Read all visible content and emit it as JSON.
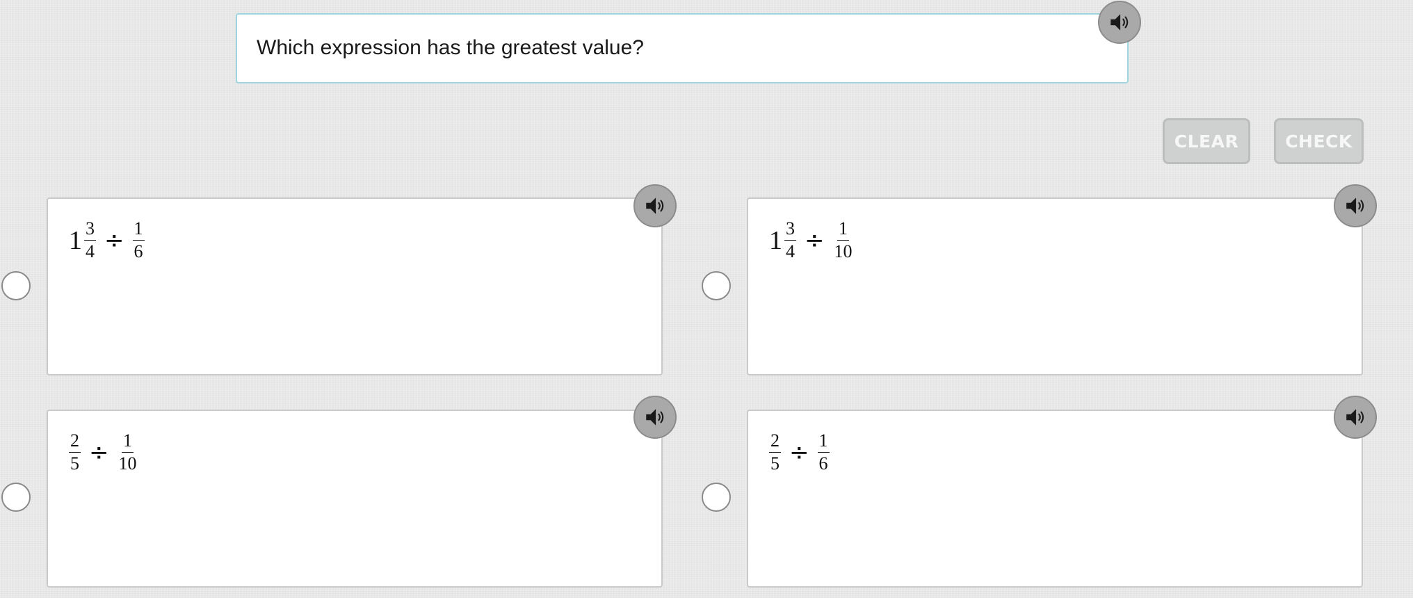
{
  "question": {
    "text": "Which expression has the greatest value?"
  },
  "buttons": {
    "clear_label": "CLEAR",
    "check_label": "CHECK"
  },
  "icons": {
    "audio": "speaker-icon",
    "radio": "radio-unselected-icon"
  },
  "colors": {
    "question_border": "#9fd5e0",
    "button_bg": "#cfd0d0",
    "audio_button_bg": "#a9a9a9"
  },
  "options": [
    {
      "whole": "1",
      "frac1_num": "3",
      "frac1_den": "4",
      "operator": "÷",
      "frac2_num": "1",
      "frac2_den": "6"
    },
    {
      "whole": "1",
      "frac1_num": "3",
      "frac1_den": "4",
      "operator": "÷",
      "frac2_num": "1",
      "frac2_den": "10"
    },
    {
      "whole": "",
      "frac1_num": "2",
      "frac1_den": "5",
      "operator": "÷",
      "frac2_num": "1",
      "frac2_den": "10"
    },
    {
      "whole": "",
      "frac1_num": "2",
      "frac1_den": "5",
      "operator": "÷",
      "frac2_num": "1",
      "frac2_den": "6"
    }
  ]
}
